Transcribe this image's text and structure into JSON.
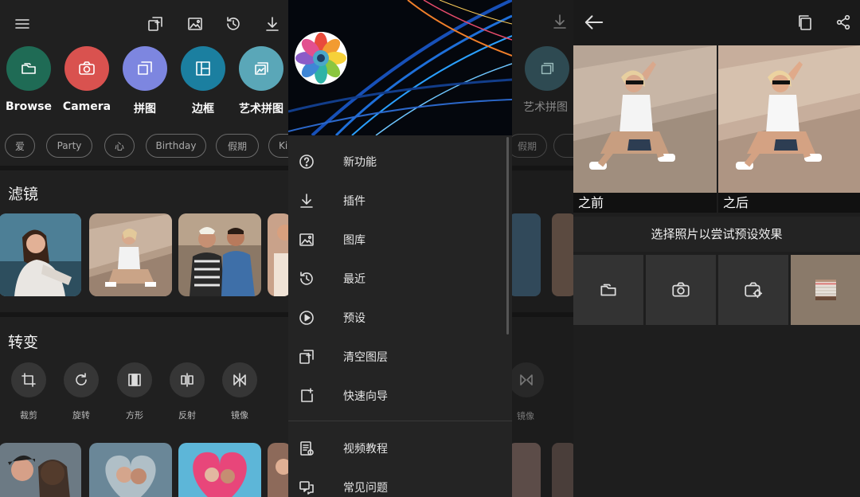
{
  "left_panel": {
    "actions": [
      {
        "label": "Browse",
        "color": "#1f6b55"
      },
      {
        "label": "Camera",
        "color": "#d9524f"
      },
      {
        "label": "拼图",
        "color": "#7d86e0"
      },
      {
        "label": "边框",
        "color": "#1b7fa0"
      },
      {
        "label": "艺术拼图",
        "color": "#5aa7b8"
      }
    ],
    "chips": [
      "爱",
      "Party",
      "心",
      "Birthday",
      "假期",
      "Ki"
    ],
    "filters_title": "滤镜",
    "transform_title": "转变",
    "tools": [
      "裁剪",
      "旋转",
      "方形",
      "反射",
      "镜像"
    ]
  },
  "drawer": {
    "items": [
      {
        "label": "新功能",
        "icon": "help-icon"
      },
      {
        "label": "插件",
        "icon": "download-icon"
      },
      {
        "label": "图库",
        "icon": "gallery-icon"
      },
      {
        "label": "最近",
        "icon": "history-icon"
      },
      {
        "label": "预设",
        "icon": "play-icon"
      },
      {
        "label": "清空图层",
        "icon": "clear-layers-icon"
      },
      {
        "label": "快速向导",
        "icon": "quick-guide-icon"
      },
      {
        "label": "视频教程",
        "icon": "video-tutorial-icon"
      },
      {
        "label": "常见问题",
        "icon": "faq-icon"
      }
    ]
  },
  "behind_drawer": {
    "action_label": "艺术拼图",
    "chip": "假期",
    "tool_label": "镜像"
  },
  "preset_panel": {
    "before_label": "之前",
    "after_label": "之后",
    "prompt": "选择照片以尝试预设效果"
  }
}
